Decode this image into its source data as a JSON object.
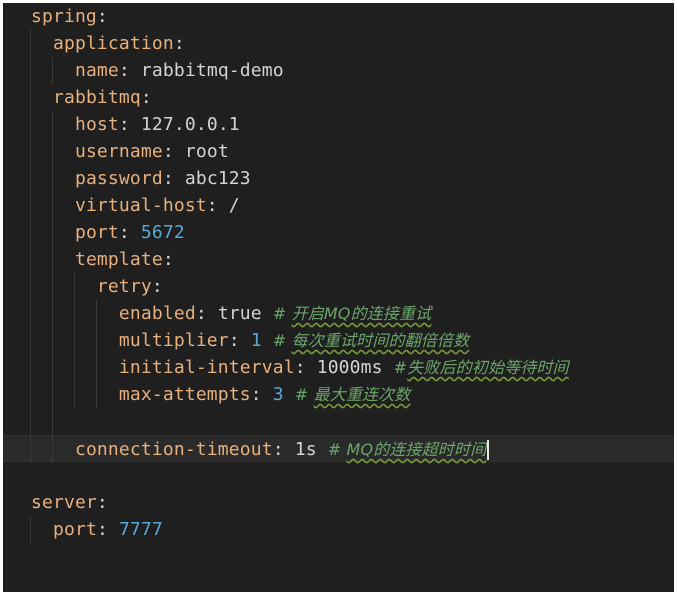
{
  "editor": {
    "language": "yaml",
    "lines": [
      {
        "indent": 0,
        "key": "spring",
        "value": "",
        "value_type": "none",
        "comment": ""
      },
      {
        "indent": 1,
        "key": "application",
        "value": "",
        "value_type": "none",
        "comment": ""
      },
      {
        "indent": 2,
        "key": "name",
        "value": "rabbitmq-demo",
        "value_type": "text",
        "comment": ""
      },
      {
        "indent": 1,
        "key": "rabbitmq",
        "value": "",
        "value_type": "none",
        "comment": ""
      },
      {
        "indent": 2,
        "key": "host",
        "value": "127.0.0.1",
        "value_type": "text",
        "comment": ""
      },
      {
        "indent": 2,
        "key": "username",
        "value": "root",
        "value_type": "text",
        "comment": ""
      },
      {
        "indent": 2,
        "key": "password",
        "value": "abc123",
        "value_type": "text",
        "comment": ""
      },
      {
        "indent": 2,
        "key": "virtual-host",
        "value": "/",
        "value_type": "text",
        "comment": ""
      },
      {
        "indent": 2,
        "key": "port",
        "value": "5672",
        "value_type": "number",
        "comment": ""
      },
      {
        "indent": 2,
        "key": "template",
        "value": "",
        "value_type": "none",
        "comment": ""
      },
      {
        "indent": 3,
        "key": "retry",
        "value": "",
        "value_type": "none",
        "comment": ""
      },
      {
        "indent": 4,
        "key": "enabled",
        "value": "true",
        "value_type": "text",
        "comment_prefix": "# ",
        "comment": "开启MQ的连接重试"
      },
      {
        "indent": 4,
        "key": "multiplier",
        "value": "1",
        "value_type": "number",
        "comment_prefix": "# ",
        "comment": "每次重试时间的翻倍倍数"
      },
      {
        "indent": 4,
        "key": "initial-interval",
        "value": "1000ms",
        "value_type": "text",
        "comment_prefix": "#",
        "comment": "失败后的初始等待时间"
      },
      {
        "indent": 4,
        "key": "max-attempts",
        "value": "3",
        "value_type": "number",
        "comment_prefix": "# ",
        "comment": "最大重连次数"
      },
      {
        "indent": 0,
        "key": "",
        "value": "",
        "value_type": "blank",
        "comment": ""
      },
      {
        "indent": 2,
        "key": "connection-timeout",
        "value": "1s",
        "value_type": "text",
        "comment_prefix": "# ",
        "comment": "MQ的连接超时时间",
        "current": true
      },
      {
        "indent": 0,
        "key": "",
        "value": "",
        "value_type": "blank",
        "comment": ""
      },
      {
        "indent": 0,
        "key": "server",
        "value": "",
        "value_type": "none",
        "comment": ""
      },
      {
        "indent": 1,
        "key": "port",
        "value": "7777",
        "value_type": "number",
        "comment": ""
      }
    ]
  },
  "colors": {
    "background": "#1f1f1f",
    "key": "#e8b07c",
    "text_value": "#d4d4d4",
    "number_value": "#57a9d4",
    "comment": "#6aa66a"
  }
}
